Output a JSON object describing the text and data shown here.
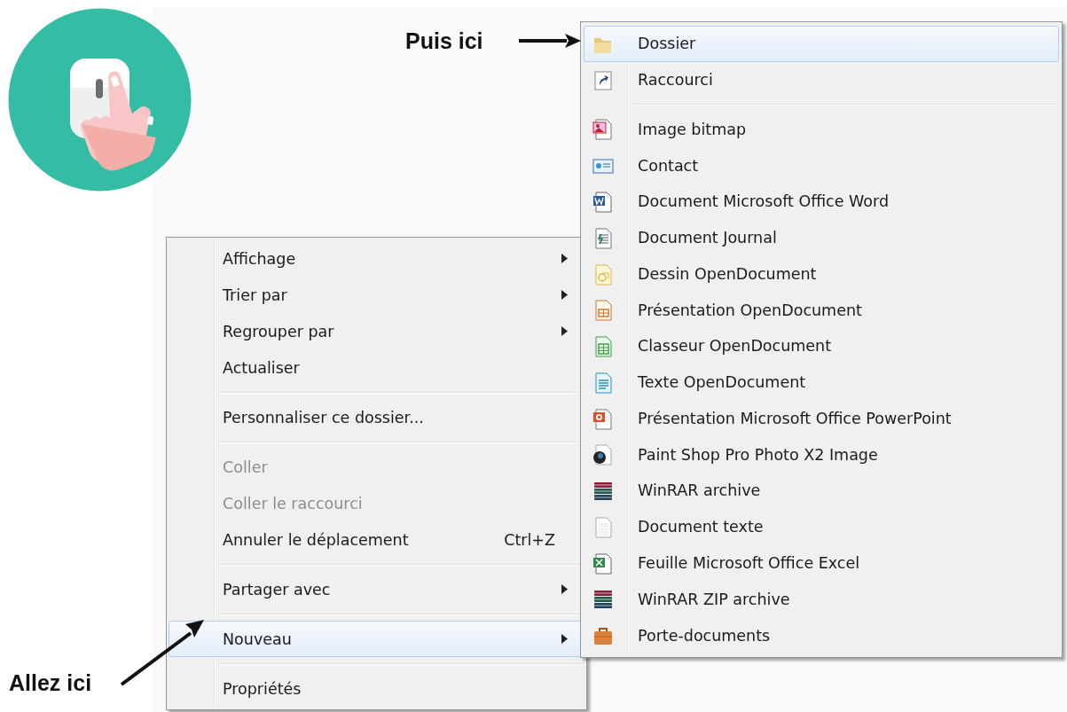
{
  "annotations": [
    {
      "text": "Puis ici"
    },
    {
      "text": "Allez ici"
    }
  ],
  "context_menu": {
    "items": [
      {
        "kind": "item",
        "label": "Affichage",
        "submenu": true,
        "disabled": false,
        "selected": false
      },
      {
        "kind": "item",
        "label": "Trier par",
        "submenu": true,
        "disabled": false,
        "selected": false
      },
      {
        "kind": "item",
        "label": "Regrouper par",
        "submenu": true,
        "disabled": false,
        "selected": false
      },
      {
        "kind": "item",
        "label": "Actualiser",
        "submenu": false,
        "disabled": false,
        "selected": false
      },
      {
        "kind": "separator"
      },
      {
        "kind": "item",
        "label": "Personnaliser ce dossier...",
        "submenu": false,
        "disabled": false,
        "selected": false
      },
      {
        "kind": "separator"
      },
      {
        "kind": "item",
        "label": "Coller",
        "submenu": false,
        "disabled": true,
        "selected": false
      },
      {
        "kind": "item",
        "label": "Coller le raccourci",
        "submenu": false,
        "disabled": true,
        "selected": false
      },
      {
        "kind": "item",
        "label": "Annuler le déplacement",
        "shortcut": "Ctrl+Z",
        "submenu": false,
        "disabled": false,
        "selected": false
      },
      {
        "kind": "separator"
      },
      {
        "kind": "item",
        "label": "Partager avec",
        "submenu": true,
        "disabled": false,
        "selected": false
      },
      {
        "kind": "separator"
      },
      {
        "kind": "item",
        "label": "Nouveau",
        "submenu": true,
        "disabled": false,
        "selected": true
      },
      {
        "kind": "separator"
      },
      {
        "kind": "item",
        "label": "Propriétés",
        "submenu": false,
        "disabled": false,
        "selected": false
      }
    ]
  },
  "new_submenu": {
    "items": [
      {
        "kind": "folder",
        "label": "Dossier",
        "selected": true
      },
      {
        "kind": "shortcut",
        "label": "Raccourci",
        "selected": false
      },
      {
        "kind": "separator"
      },
      {
        "kind": "bitmap",
        "label": "Image bitmap",
        "selected": false
      },
      {
        "kind": "contact",
        "label": "Contact",
        "selected": false
      },
      {
        "kind": "word",
        "label": "Document Microsoft Office Word",
        "selected": false
      },
      {
        "kind": "journal",
        "label": "Document Journal",
        "selected": false
      },
      {
        "kind": "draw",
        "label": "Dessin OpenDocument",
        "selected": false
      },
      {
        "kind": "impress",
        "label": "Présentation OpenDocument",
        "selected": false
      },
      {
        "kind": "calc",
        "label": "Classeur OpenDocument",
        "selected": false
      },
      {
        "kind": "writer",
        "label": "Texte OpenDocument",
        "selected": false
      },
      {
        "kind": "powerpoint",
        "label": "Présentation Microsoft Office PowerPoint",
        "selected": false
      },
      {
        "kind": "psp",
        "label": "Paint Shop Pro Photo X2 Image",
        "selected": false
      },
      {
        "kind": "archive",
        "label": "WinRAR archive",
        "selected": false
      },
      {
        "kind": "text",
        "label": "Document texte",
        "selected": false
      },
      {
        "kind": "excel",
        "label": "Feuille Microsoft Office Excel",
        "selected": false
      },
      {
        "kind": "archive",
        "label": "WinRAR ZIP archive",
        "selected": false
      },
      {
        "kind": "briefcase",
        "label": "Porte-documents",
        "selected": false
      }
    ]
  }
}
